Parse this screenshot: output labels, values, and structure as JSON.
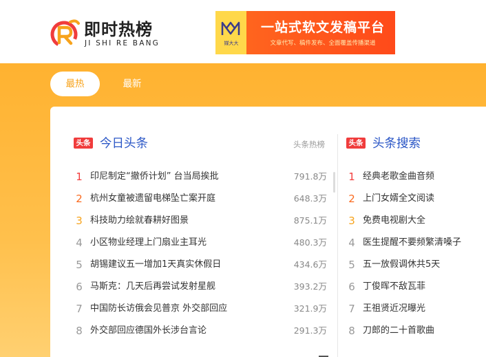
{
  "brand": {
    "name_cn": "即时热榜",
    "name_py": "JI SHI RE BANG",
    "colors": {
      "accent": "#f7a31c",
      "red": "#f03c3c",
      "link_blue": "#2a56c6"
    }
  },
  "ad": {
    "badge_text": "媒大大",
    "title": "一站式软文发稿平台",
    "subtitle": "文章代写、稿件发布、全面覆盖传播渠道"
  },
  "tabs": [
    {
      "label": "最热",
      "active": true
    },
    {
      "label": "最新",
      "active": false
    }
  ],
  "left_section": {
    "tag": "头条",
    "title": "今日头条",
    "source": "头条热榜",
    "items": [
      {
        "rank": "1",
        "title": "印尼制定“撤侨计划” 台当局挨批",
        "heat": "791.8万"
      },
      {
        "rank": "2",
        "title": "杭州女童被遗留电梯坠亡案开庭",
        "heat": "648.3万"
      },
      {
        "rank": "3",
        "title": "科技助力绘就春耕好图景",
        "heat": "875.1万"
      },
      {
        "rank": "4",
        "title": "小区物业经理上门扇业主耳光",
        "heat": "480.3万"
      },
      {
        "rank": "5",
        "title": "胡锡建议五一增加1天真实休假日",
        "heat": "434.6万"
      },
      {
        "rank": "6",
        "title": "马斯克：几天后再尝试发射星舰",
        "heat": "393.2万"
      },
      {
        "rank": "7",
        "title": "中国防长访俄会见普京 外交部回应",
        "heat": "321.9万"
      },
      {
        "rank": "8",
        "title": "外交部回应德国外长涉台言论",
        "heat": "291.3万"
      }
    ]
  },
  "right_section": {
    "tag": "头条",
    "title": "头条搜索",
    "items": [
      {
        "rank": "1",
        "title": "经典老歌金曲音频"
      },
      {
        "rank": "2",
        "title": "上门女婿全文阅读"
      },
      {
        "rank": "3",
        "title": "免费电视剧大全"
      },
      {
        "rank": "4",
        "title": "医生提醒不要频繁清嗓子"
      },
      {
        "rank": "5",
        "title": "五一放假调休共5天"
      },
      {
        "rank": "6",
        "title": "丁俊晖不敌瓦菲"
      },
      {
        "rank": "7",
        "title": "王祖贤近况曝光"
      },
      {
        "rank": "8",
        "title": "刀郎的二十首歌曲"
      }
    ]
  }
}
